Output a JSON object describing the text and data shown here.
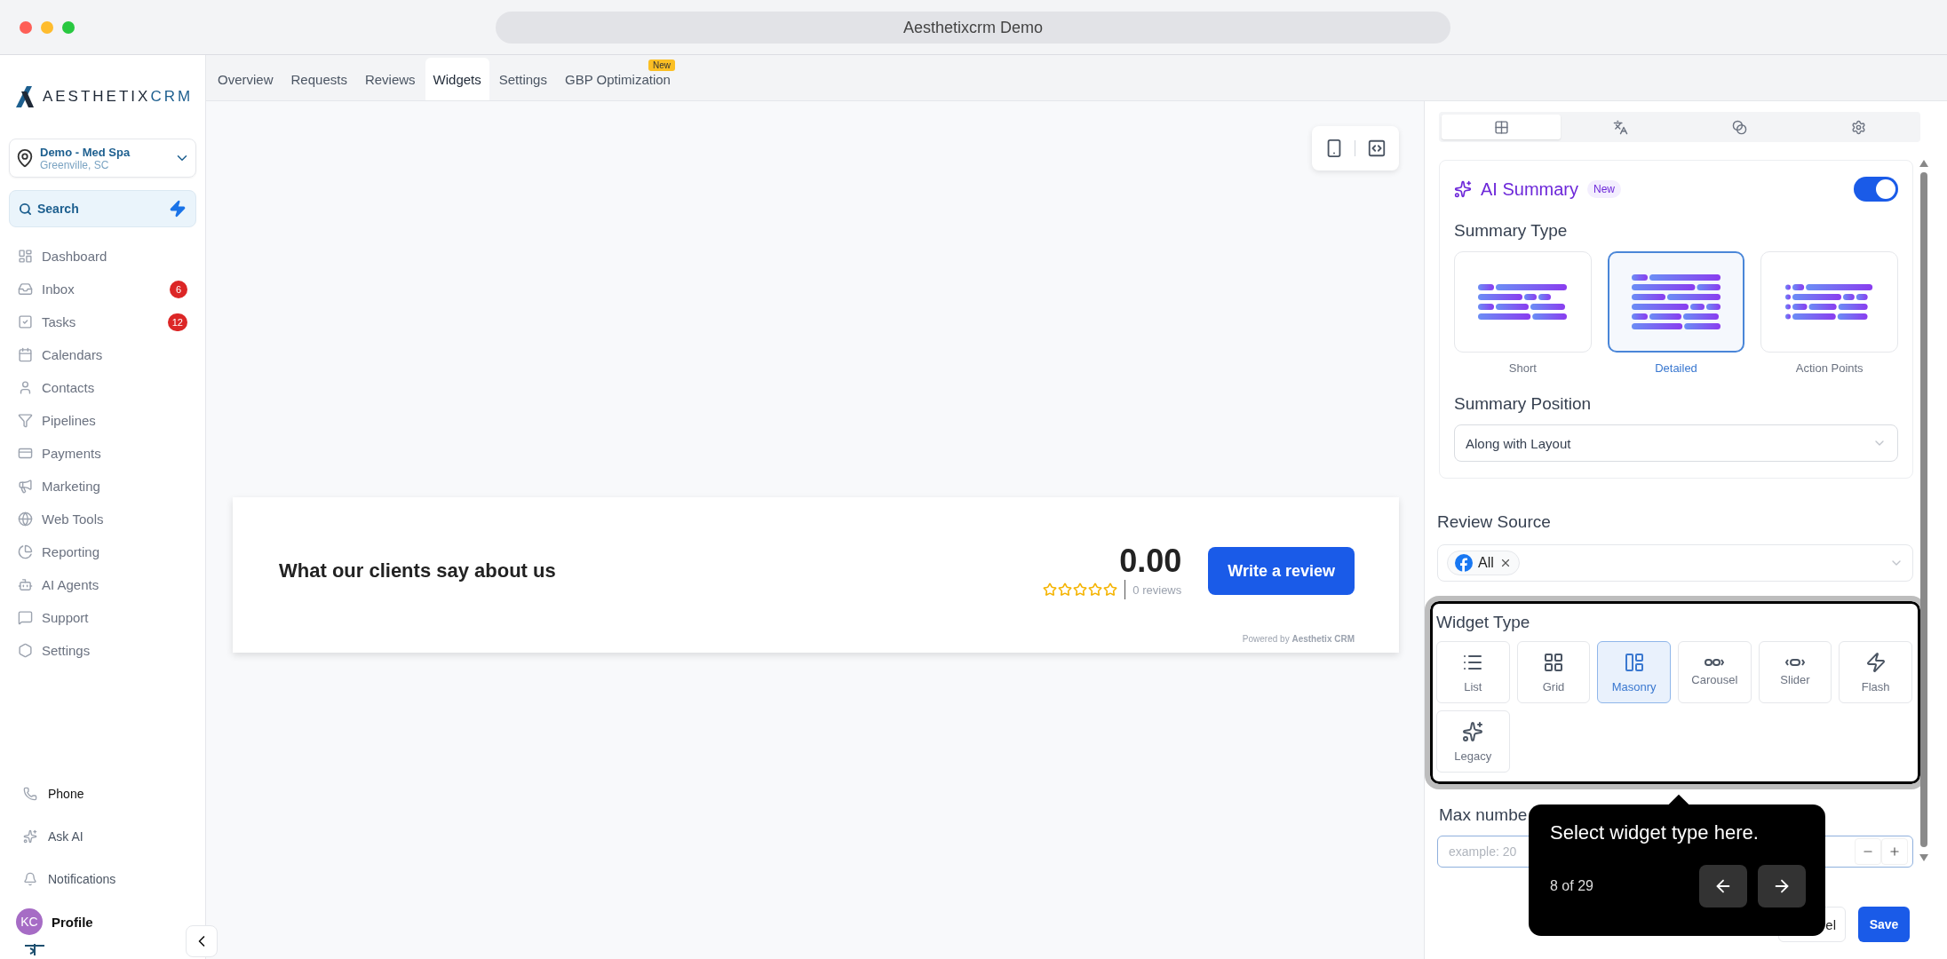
{
  "window": {
    "title": "Aesthetixcrm Demo"
  },
  "sidebar": {
    "brand": {
      "part_a": "AESTHETIX",
      "part_b": "CRM"
    },
    "location": {
      "name": "Demo - Med Spa",
      "city": "Greenville, SC"
    },
    "search": {
      "label": "Search"
    },
    "nav": [
      {
        "label": "Dashboard"
      },
      {
        "label": "Inbox",
        "badge": "6"
      },
      {
        "label": "Tasks",
        "badge": "12"
      },
      {
        "label": "Calendars"
      },
      {
        "label": "Contacts"
      },
      {
        "label": "Pipelines"
      },
      {
        "label": "Payments"
      },
      {
        "label": "Marketing"
      },
      {
        "label": "Web Tools"
      },
      {
        "label": "Reporting"
      },
      {
        "label": "AI Agents"
      },
      {
        "label": "Support"
      },
      {
        "label": "Settings"
      }
    ],
    "footer": [
      {
        "label": "Phone"
      },
      {
        "label": "Ask AI"
      },
      {
        "label": "Notifications"
      }
    ],
    "profile": {
      "initials": "KC",
      "label": "Profile"
    }
  },
  "tabs": [
    {
      "label": "Overview",
      "selected": false
    },
    {
      "label": "Requests",
      "selected": false
    },
    {
      "label": "Reviews",
      "selected": false
    },
    {
      "label": "Widgets",
      "selected": true
    },
    {
      "label": "Settings",
      "selected": false
    },
    {
      "label": "GBP Optimization",
      "selected": false,
      "badge": "New"
    }
  ],
  "widget": {
    "title": "What our clients say about us",
    "rating": "0.00",
    "stars": 0,
    "count": "0 reviews",
    "button": "Write a review",
    "powered": "Powered by **Aesthetix CRM**"
  },
  "panel": {
    "tabs": [
      {
        "selected": true
      },
      {
        "selected": false
      },
      {
        "selected": false
      },
      {
        "selected": false
      }
    ],
    "ai_summary": {
      "title": "AI Summary",
      "badge": "New",
      "on": true,
      "type_label": "Summary Type",
      "types": [
        {
          "label": "Short",
          "kind": "short",
          "selected": false
        },
        {
          "label": "Detailed",
          "kind": "detailed",
          "selected": true
        },
        {
          "label": "Action Points",
          "kind": "action",
          "selected": false
        }
      ],
      "position_label": "Summary Position",
      "position_value": "Along with Layout"
    },
    "review_source": {
      "label": "Review Source",
      "chip": "All"
    },
    "widget_type": {
      "label": "Widget Type",
      "options": [
        {
          "label": "List",
          "selected": false
        },
        {
          "label": "Grid",
          "selected": false
        },
        {
          "label": "Masonry",
          "selected": true
        },
        {
          "label": "Carousel",
          "selected": false
        },
        {
          "label": "Slider",
          "selected": false
        },
        {
          "label": "Flash",
          "selected": false
        },
        {
          "label": "Legacy",
          "selected": false
        }
      ]
    },
    "max_number": {
      "label": "Max numbe",
      "placeholder": "example: 20"
    },
    "cancel": "el",
    "save": "Save"
  },
  "tour": {
    "text": "Select widget type here.",
    "counter": "8 of 29"
  }
}
